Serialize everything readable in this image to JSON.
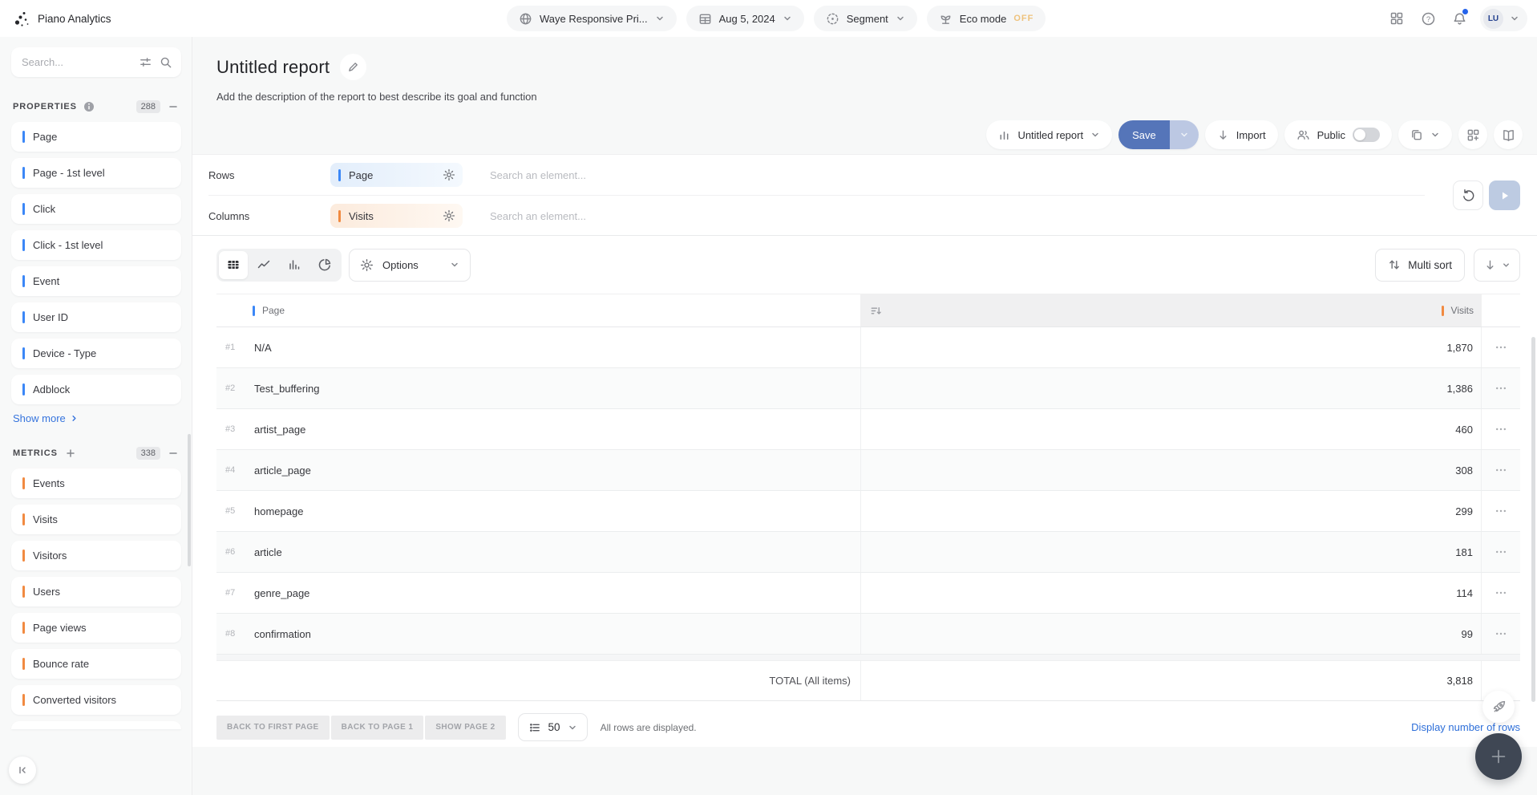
{
  "topbar": {
    "app_name": "Piano Analytics",
    "site": "Waye Responsive Pri...",
    "date": "Aug 5, 2024",
    "segment": "Segment",
    "eco": "Eco mode",
    "eco_state": "OFF",
    "avatar": "LU"
  },
  "sidebar": {
    "search_placeholder": "Search...",
    "properties": {
      "title": "PROPERTIES",
      "count": "288",
      "items": [
        "Page",
        "Page - 1st level",
        "Click",
        "Click - 1st level",
        "Event",
        "User ID",
        "Device - Type",
        "Adblock"
      ],
      "show_more": "Show more"
    },
    "metrics": {
      "title": "METRICS",
      "count": "338",
      "items": [
        "Events",
        "Visits",
        "Visitors",
        "Users",
        "Page views",
        "Bounce rate",
        "Converted visitors"
      ]
    }
  },
  "report": {
    "title": "Untitled report",
    "description": "Add the description of the report to best describe its goal and function"
  },
  "toolbar": {
    "report_selector": "Untitled report",
    "save": "Save",
    "import": "Import",
    "public": "Public"
  },
  "builder": {
    "rows_label": "Rows",
    "rows_element": "Page",
    "columns_label": "Columns",
    "columns_element": "Visits",
    "search_placeholder": "Search an element..."
  },
  "controls": {
    "options": "Options",
    "multi_sort": "Multi sort"
  },
  "table": {
    "columns": {
      "page": "Page",
      "visits": "Visits"
    },
    "rows": [
      {
        "rank": "#1",
        "page": "N/A",
        "visits": "1,870"
      },
      {
        "rank": "#2",
        "page": "Test_buffering",
        "visits": "1,386"
      },
      {
        "rank": "#3",
        "page": "artist_page",
        "visits": "460"
      },
      {
        "rank": "#4",
        "page": "article_page",
        "visits": "308"
      },
      {
        "rank": "#5",
        "page": "homepage",
        "visits": "299"
      },
      {
        "rank": "#6",
        "page": "article",
        "visits": "181"
      },
      {
        "rank": "#7",
        "page": "genre_page",
        "visits": "114"
      },
      {
        "rank": "#8",
        "page": "confirmation",
        "visits": "99"
      }
    ],
    "total_label": "TOTAL (All items)",
    "total_value": "3,818"
  },
  "pagination": {
    "back_first": "BACK TO FIRST PAGE",
    "back_page1": "BACK TO PAGE 1",
    "show_page2": "SHOW PAGE 2",
    "page_size": "50",
    "status": "All rows are displayed.",
    "display_rows_link": "Display number of rows"
  },
  "icons": {
    "help": "?"
  },
  "colors": {
    "accent_blue": "#3b87f7",
    "accent_orange": "#f18a41",
    "save_button": "#5575b9",
    "eco_off": "#eec27c",
    "link_blue": "#2e6fd9",
    "notification_dot": "#2563eb",
    "fab_background": "#3f4754"
  }
}
